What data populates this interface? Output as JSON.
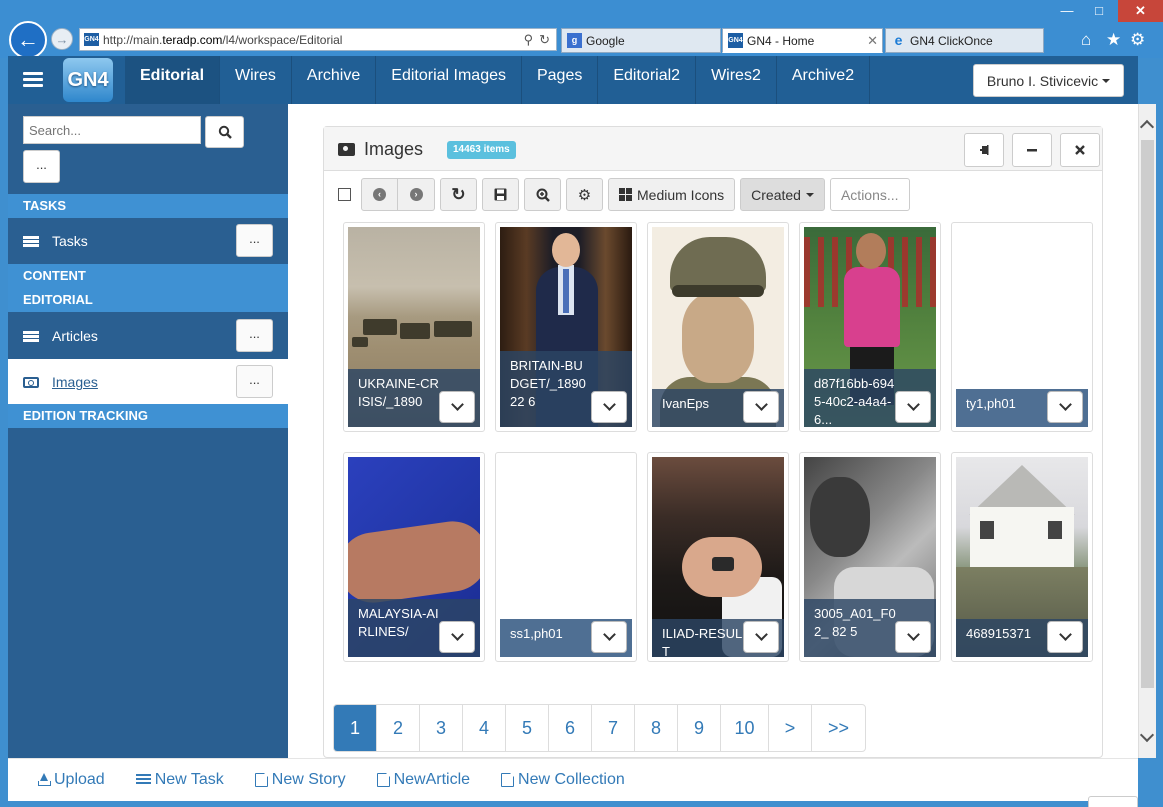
{
  "browser": {
    "url_prefix": "http://main.",
    "url_domain": "teradp.com",
    "url_path": "/l4/workspace/Editorial",
    "tabs": [
      {
        "title": "Google",
        "favicon": "google-icon"
      },
      {
        "title": "GN4 - Home",
        "favicon": "gn4-icon"
      },
      {
        "title": "GN4 ClickOnce",
        "favicon": "ie-icon"
      }
    ],
    "favicon_text": "GN4",
    "close_glyph": "✕"
  },
  "app": {
    "logo_text": "GN4",
    "nav": [
      "Editorial",
      "Wires",
      "Archive",
      "Editorial Images",
      "Pages",
      "Editorial2",
      "Wires2",
      "Archive2"
    ],
    "active_nav": "Editorial",
    "user": "Bruno I. Stivicevic"
  },
  "sidebar": {
    "search_placeholder": "Search...",
    "more_label": "...",
    "sections": {
      "tasks": "TASKS",
      "content": "CONTENT",
      "editorial": "EDITORIAL",
      "edition_tracking": "EDITION TRACKING"
    },
    "items": {
      "tasks": "Tasks",
      "articles": "Articles",
      "images": "Images"
    }
  },
  "panel": {
    "title": "Images",
    "count_badge": "14463 items",
    "toolbar": {
      "view_label": "Medium Icons",
      "sort_label": "Created",
      "actions_label": "Actions..."
    },
    "thumbnails": [
      {
        "caption": "UKRAINE-CRISIS/_1890",
        "image": "ukraine-military-vehicles"
      },
      {
        "caption": "BRITAIN-BUDGET/_189022 6",
        "image": "man-in-suit"
      },
      {
        "caption": "IvanEps",
        "image": "soldier-portrait"
      },
      {
        "caption": "d87f16bb-6945-40c2-a4a4-6...",
        "image": "soccer-player"
      },
      {
        "caption": "ty1,ph01",
        "image": "blank"
      },
      {
        "caption": "MALAYSIA-AIRLINES/",
        "image": "hand-blue-background"
      },
      {
        "caption": "ss1,ph01",
        "image": "blank"
      },
      {
        "caption": "ILIAD-RESULT",
        "image": "hands-with-phone"
      },
      {
        "caption": "3005_A01_F02_ 82 5",
        "image": "black-and-white-portrait"
      },
      {
        "caption": "468915371",
        "image": "flooded-cottage"
      }
    ],
    "pagination": [
      "1",
      "2",
      "3",
      "4",
      "5",
      "6",
      "7",
      "8",
      "9",
      "10",
      ">",
      ">>"
    ],
    "current_page": "1"
  },
  "footer": {
    "upload": "Upload",
    "new_task": "New Task",
    "new_story": "New Story",
    "new_article": "NewArticle",
    "new_collection": "New Collection"
  },
  "colors": {
    "navbar": "#215f95",
    "sidebar": "#2a5f91",
    "section_header": "#3f91d3",
    "badge": "#5bc0de",
    "link": "#337ab7"
  }
}
